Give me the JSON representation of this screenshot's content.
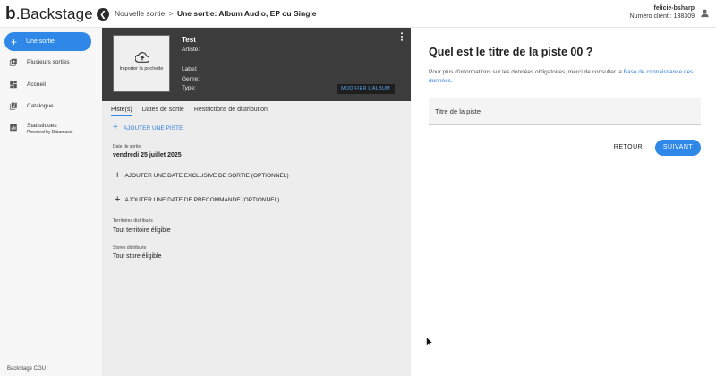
{
  "app": {
    "logo_letter": "b",
    "logo_rest": ".Backstage"
  },
  "breadcrumb": {
    "parent": "Nouvelle sortie",
    "separator": ">",
    "current": "Une sortie: Album Audio, EP ou Single"
  },
  "user": {
    "name": "felicie-bsharp",
    "client": "Numéro client : 138309",
    "icon": "account-icon"
  },
  "sidebar": {
    "new_button": "Une sortie",
    "items": [
      {
        "label": "Plusieurs sorties",
        "icon": "add-box-icon"
      },
      {
        "label": "Accueil",
        "icon": "dashboard-icon"
      },
      {
        "label": "Catalogue",
        "icon": "library-music-icon"
      },
      {
        "label": "Statistiques",
        "sub": "Powered by Datamusic",
        "icon": "bar-chart-icon"
      }
    ],
    "footer": "Backstage CGU"
  },
  "album": {
    "cover_label": "Importer la pochette",
    "title": "Test",
    "artist_label": "Artiste:",
    "label_label": "Label:",
    "genre_label": "Genre:",
    "type_label": "Type:",
    "modify_button": "MODIFIER L'ALBUM"
  },
  "tabs": [
    {
      "label": "Piste(s)",
      "active": true
    },
    {
      "label": "Dates de sortie",
      "active": false
    },
    {
      "label": "Restrictions de distribution",
      "active": false
    }
  ],
  "tracks": {
    "add_track": "AJOUTER UNE PISTE",
    "release_date_label": "Date de sortie",
    "release_date": "vendredi 25 juillet 2025",
    "add_exclusive_date": "AJOUTER UNE DATE EXCLUSIVE DE SORTIE (OPTIONNEL)",
    "add_preorder_date": "AJOUTER UNE DATE DE PRECOMMANDE (OPTIONNEL)",
    "territories_label": "Territoires distribués",
    "territories_value": "Tout territoire éligible",
    "stores_label": "Stores distribués",
    "stores_value": "Tout store éligible"
  },
  "question": {
    "title": "Quel est le titre de la piste 00 ?",
    "info_prefix": "Pour plus d'informations sur les données obligatoires, merci de consulter la",
    "info_link": "Base de connaissance des données.",
    "input_placeholder": "Titre de la piste",
    "back_button": "RETOUR",
    "next_button": "SUIVANT"
  },
  "colors": {
    "accent": "#2f88e8",
    "header_dark": "#3c3c3c",
    "sidebar_bg": "#f7f7f7",
    "middle_bg": "#ededed"
  }
}
